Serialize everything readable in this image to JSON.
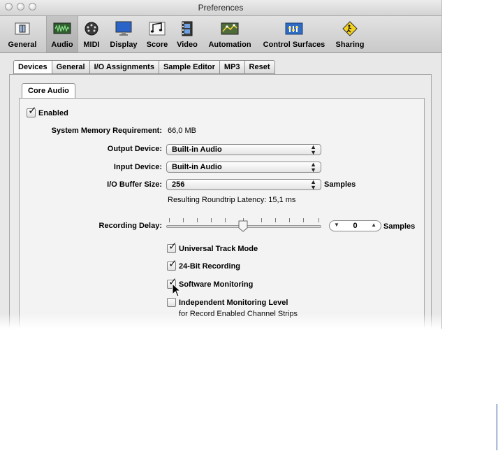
{
  "window": {
    "title": "Preferences"
  },
  "toolbar": {
    "items": [
      {
        "label": "General",
        "icon": "general-icon"
      },
      {
        "label": "Audio",
        "icon": "audio-icon",
        "selected": true
      },
      {
        "label": "MIDI",
        "icon": "midi-icon"
      },
      {
        "label": "Display",
        "icon": "display-icon"
      },
      {
        "label": "Score",
        "icon": "score-icon"
      },
      {
        "label": "Video",
        "icon": "video-icon"
      },
      {
        "label": "Automation",
        "icon": "automation-icon"
      },
      {
        "label": "Control Surfaces",
        "icon": "control-surfaces-icon"
      },
      {
        "label": "Sharing",
        "icon": "sharing-icon"
      }
    ]
  },
  "tabs": [
    {
      "label": "Devices",
      "selected": true
    },
    {
      "label": "General"
    },
    {
      "label": "I/O Assignments"
    },
    {
      "label": "Sample Editor"
    },
    {
      "label": "MP3"
    },
    {
      "label": "Reset"
    }
  ],
  "subtab": {
    "label": "Core Audio"
  },
  "core_audio": {
    "enabled": {
      "label": "Enabled",
      "checked": true
    },
    "memory": {
      "label": "System Memory Requirement:",
      "value": "66,0 MB"
    },
    "output_device": {
      "label": "Output Device:",
      "value": "Built-in Audio"
    },
    "input_device": {
      "label": "Input Device:",
      "value": "Built-in Audio"
    },
    "buffer_size": {
      "label": "I/O Buffer Size:",
      "value": "256",
      "unit": "Samples"
    },
    "latency": {
      "text": "Resulting Roundtrip Latency: 15,1 ms"
    },
    "recording_delay": {
      "label": "Recording Delay:",
      "value": "0",
      "unit": "Samples",
      "slider_position": 0.5
    },
    "universal_track_mode": {
      "label": "Universal Track Mode",
      "checked": true
    },
    "bit24_recording": {
      "label": "24-Bit Recording",
      "checked": true
    },
    "software_monitoring": {
      "label": "Software Monitoring",
      "checked": true
    },
    "independent_monitoring": {
      "label": "Independent Monitoring Level",
      "sublabel": "for Record Enabled Channel Strips",
      "checked": false
    }
  },
  "colors": {
    "accent_bar": "#1f4e9e"
  }
}
